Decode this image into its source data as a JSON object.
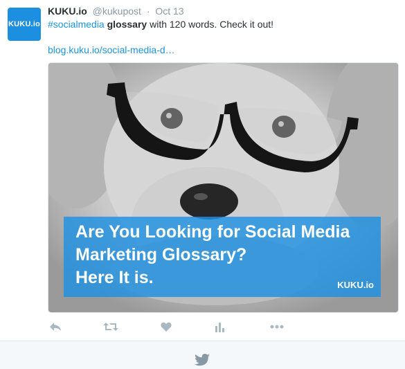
{
  "tweet": {
    "avatar_text": "KUKU.io",
    "name": "KUKU.io",
    "handle": "@kukupost",
    "separator": "·",
    "time": "Oct 13",
    "text": {
      "hashtag": "#socialmedia",
      "bold": "glossary",
      "rest": " with 120 words. Check it out!"
    },
    "link": "blog.kuku.io/social-media-d…",
    "media": {
      "banner_lines": [
        "Are You Looking for Social Media",
        "Marketing Glossary?",
        "Here It is."
      ],
      "banner_logo": "KUKU.io"
    },
    "actions": [
      {
        "name": "reply-icon"
      },
      {
        "name": "retweet-icon"
      },
      {
        "name": "like-icon"
      },
      {
        "name": "analytics-icon"
      },
      {
        "name": "more-icon"
      }
    ]
  },
  "footer": {
    "icon": "twitter-bird-icon"
  },
  "colors": {
    "accent": "#1b95e0",
    "muted": "#8899a6",
    "action_icon": "#aab8c2",
    "banner": "#1e90e0"
  }
}
